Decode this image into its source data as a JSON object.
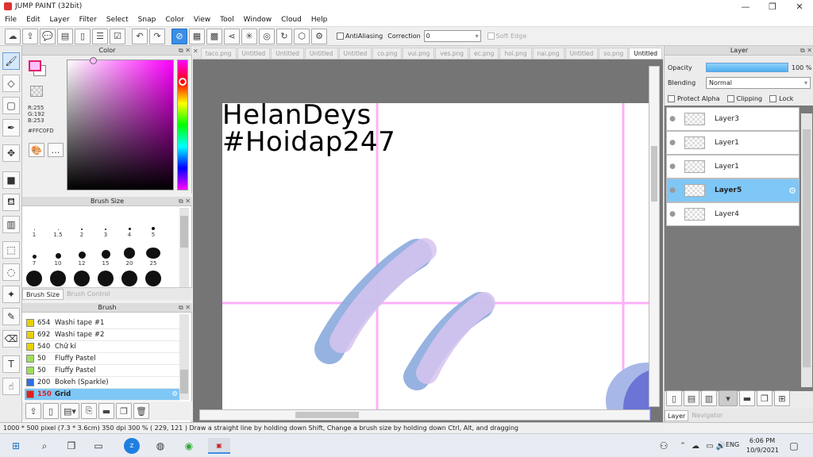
{
  "window": {
    "title": "JUMP PAINT (32bit)"
  },
  "menu": [
    "File",
    "Edit",
    "Layer",
    "Filter",
    "Select",
    "Snap",
    "Color",
    "View",
    "Tool",
    "Window",
    "Cloud",
    "Help"
  ],
  "toolbar": {
    "antialiasing_label": "AntiAliasing",
    "correction_label": "Correction",
    "correction_value": "0",
    "soft_edge_label": "Soft Edge"
  },
  "color_panel": {
    "title": "Color",
    "r": "R:255",
    "g": "G:192",
    "b": "B:253",
    "hex": "#FFC0FD"
  },
  "brush_size_panel": {
    "title": "Brush Size",
    "sizes": [
      "1",
      "1.5",
      "2",
      "3",
      "4",
      "5",
      "7",
      "10",
      "12",
      "15",
      "20",
      "25"
    ],
    "tab_active": "Brush Size",
    "tab_inactive": "Brush Control"
  },
  "brush_panel": {
    "title": "Brush",
    "items": [
      {
        "size": "654",
        "name": "Washi tape #1",
        "color": "#e8d000"
      },
      {
        "size": "692",
        "name": "Washi tape #2",
        "color": "#e8d000"
      },
      {
        "size": "540",
        "name": "Chữ kí",
        "color": "#e8d000"
      },
      {
        "size": "50",
        "name": "Fluffy Pastel",
        "color": "#9fdf5a"
      },
      {
        "size": "50",
        "name": "Fluffy Pastel",
        "color": "#9fdf5a"
      },
      {
        "size": "200",
        "name": "Bokeh (Sparkle)",
        "color": "#2e6fe0"
      },
      {
        "size": "150",
        "name": "Grid",
        "color": "#e02020"
      }
    ]
  },
  "tabs": [
    "taco.png",
    "Untitled",
    "Untitled",
    "Untitled",
    "Untitled",
    "co.png",
    "vui.png",
    "ves.png",
    "ec.png",
    "hoi.png",
    "nai.png",
    "Untitled",
    "so.png",
    "Untitled"
  ],
  "canvas": {
    "line1": "HelanDeys",
    "line2": "#Hoidap247"
  },
  "layer_panel": {
    "title": "Layer",
    "opacity_label": "Opacity",
    "opacity_value": "100 %",
    "opacity_fraction": 1.0,
    "blending_label": "Blending",
    "blending_value": "Normal",
    "protect_alpha": "Protect Alpha",
    "clipping": "Clipping",
    "lock": "Lock",
    "layers": [
      "Layer3",
      "Layer1",
      "Layer1",
      "Layer5",
      "Layer4"
    ],
    "tab_layer": "Layer",
    "tab_navigator": "Navigator"
  },
  "status": {
    "dims": "1000 * 500 pixel",
    "cm": "(7.3 * 3.6cm)",
    "dpi": "350 dpi",
    "zoom": "300 %",
    "coords": "( 229, 121 )",
    "hint": "Draw a straight line by holding down Shift, Change a brush size by holding down Ctrl, Alt, and dragging"
  },
  "taskbar": {
    "lang": "ENG",
    "time": "6:06 PM",
    "date": "10/9/2021"
  }
}
